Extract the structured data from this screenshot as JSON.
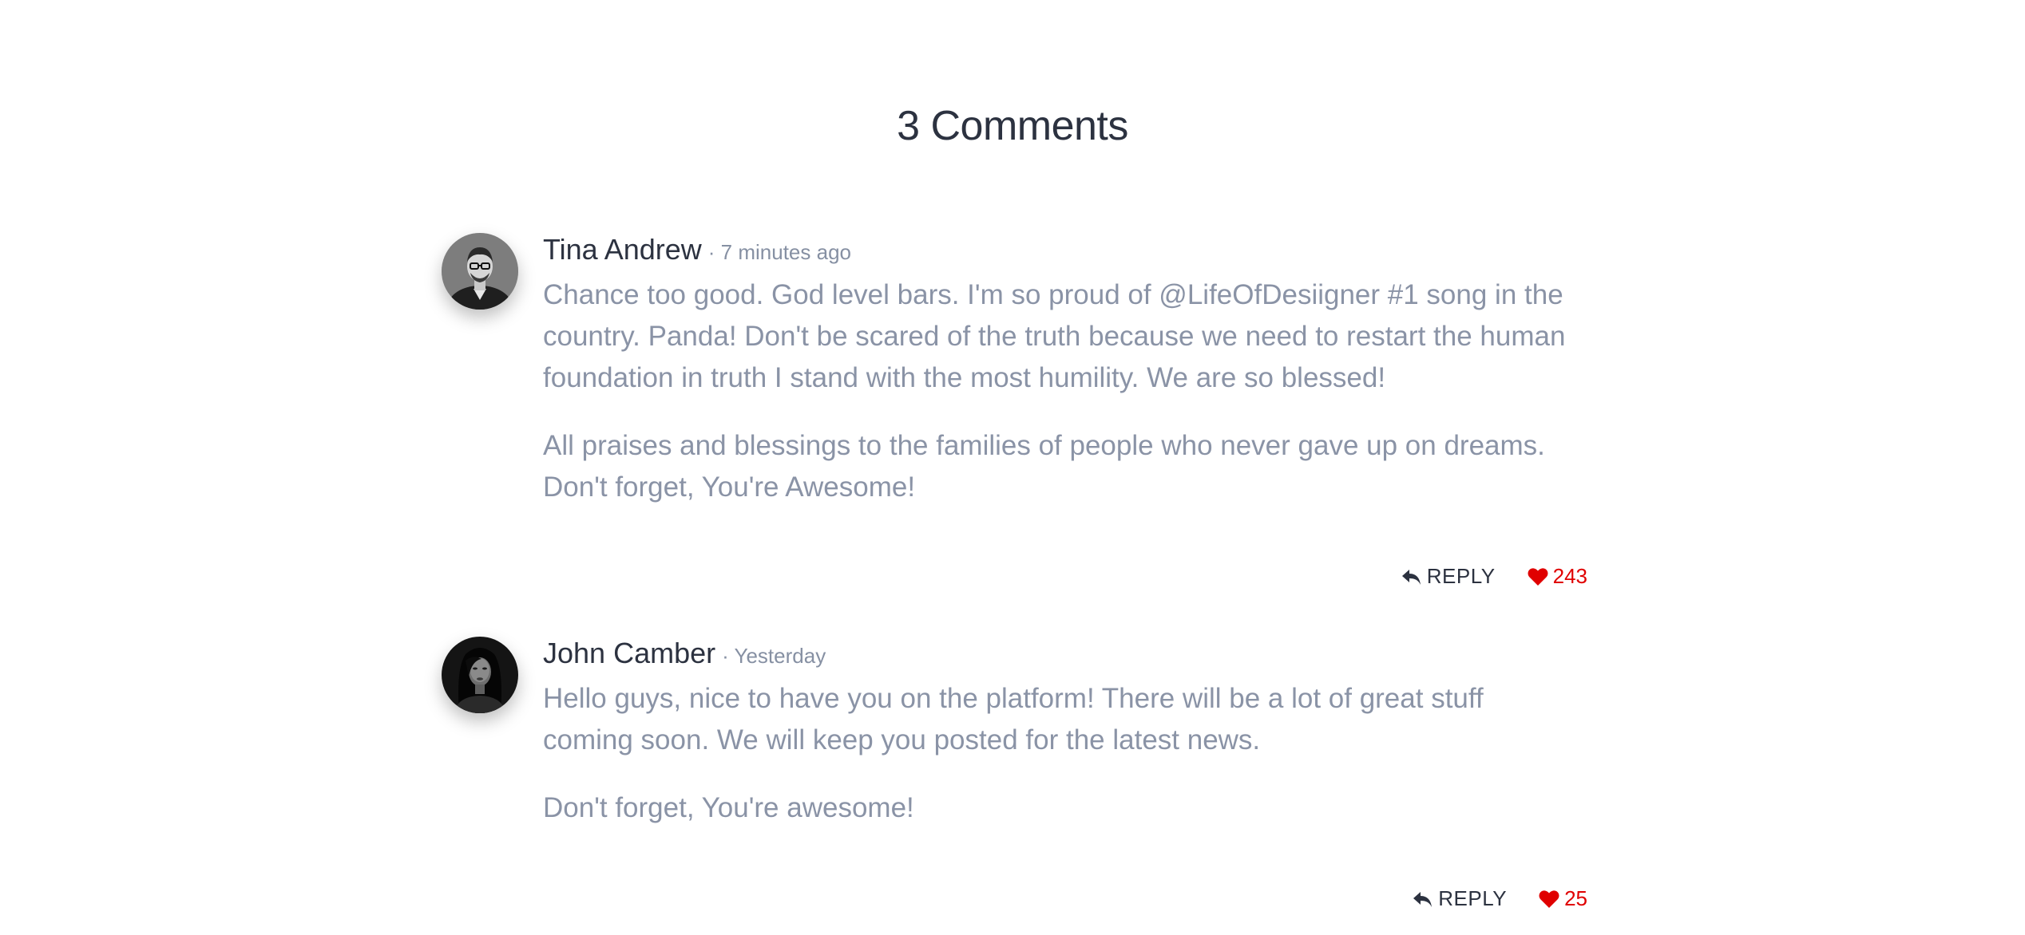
{
  "section": {
    "title": "3 Comments"
  },
  "comments": [
    {
      "author": "Tina Andrew",
      "time": "· 7 minutes ago",
      "paragraphs": [
        "Chance too good. God level bars. I'm so proud of @LifeOfDesiigner #1 song in the country. Panda! Don't be scared of the truth because we need to restart the human foundation in truth I stand with the most humility. We are so blessed!",
        "All praises and blessings to the families of people who never gave up on dreams. Don't forget, You're Awesome!"
      ],
      "reply_label": "REPLY",
      "likes": "243"
    },
    {
      "author": "John Camber",
      "time": "· Yesterday",
      "paragraphs": [
        "Hello guys, nice to have you on the platform! There will be a lot of great stuff coming soon. We will keep you posted for the latest news.",
        "Don't forget, You're awesome!"
      ],
      "reply_label": "REPLY",
      "likes": "25"
    }
  ],
  "colors": {
    "heading": "#2c3240",
    "body_text": "#8a93a6",
    "meta_text": "#8690a3",
    "like": "#e00000"
  },
  "icons": {
    "reply": "reply-arrow-icon",
    "like": "heart-icon"
  }
}
